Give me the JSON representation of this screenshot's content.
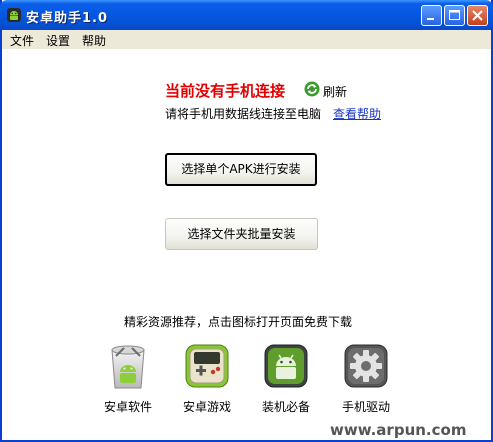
{
  "window": {
    "title": "安卓助手1.0"
  },
  "menu": [
    "文件",
    "设置",
    "帮助"
  ],
  "status": {
    "title": "当前没有手机连接",
    "refresh_label": "刷新",
    "hint": "请将手机用数据线连接至电脑",
    "help_link": "查看帮助"
  },
  "buttons": {
    "install_single": "选择单个APK进行安装",
    "install_folder": "选择文件夹批量安装"
  },
  "recommend": {
    "text": "精彩资源推荐，点击图标打开页面免费下载",
    "tiles": [
      {
        "label": "安卓软件",
        "icon": "android-bin-icon"
      },
      {
        "label": "安卓游戏",
        "icon": "gameboy-icon"
      },
      {
        "label": "装机必备",
        "icon": "android-box-icon"
      },
      {
        "label": "手机驱动",
        "icon": "gear-icon"
      }
    ]
  },
  "watermark": "www.arpun.com",
  "colors": {
    "titlebar": "#0453d6",
    "status_title": "#e20000",
    "link": "#1535c6",
    "menubar": "#ece9d8"
  }
}
